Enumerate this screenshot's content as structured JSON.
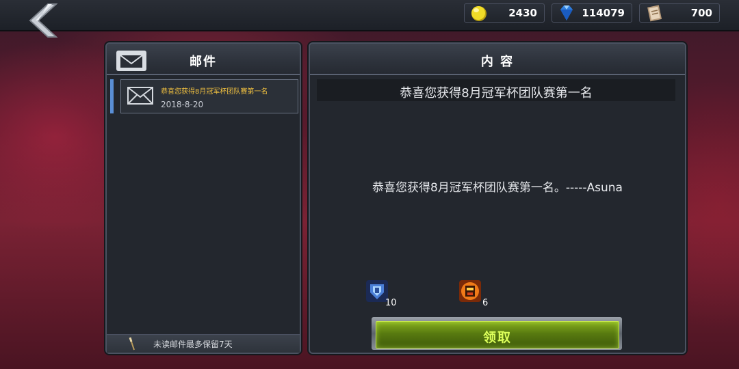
{
  "currency": {
    "gold": "2430",
    "gems": "114079",
    "tickets": "700"
  },
  "mail_panel": {
    "title": "邮件",
    "items": [
      {
        "title": "恭喜您获得8月冠军杯团队赛第一名",
        "date": "2018-8-20"
      }
    ],
    "footer_note": "未读邮件最多保留7天"
  },
  "content_panel": {
    "title": "内 容",
    "subject": "恭喜您获得8月冠军杯团队赛第一名",
    "body": "恭喜您获得8月冠军杯团队赛第一名。-----Asuna",
    "rewards": [
      {
        "icon": "blue-armor-item-icon",
        "count": "10"
      },
      {
        "icon": "orange-robot-item-icon",
        "count": "6"
      }
    ],
    "claim_label": "领取"
  },
  "colors": {
    "mail_title_gold": "#f0c040",
    "claim_green": "#587a10",
    "claim_text": "#dcff5a",
    "selected_marker": "#5a8fd6"
  }
}
